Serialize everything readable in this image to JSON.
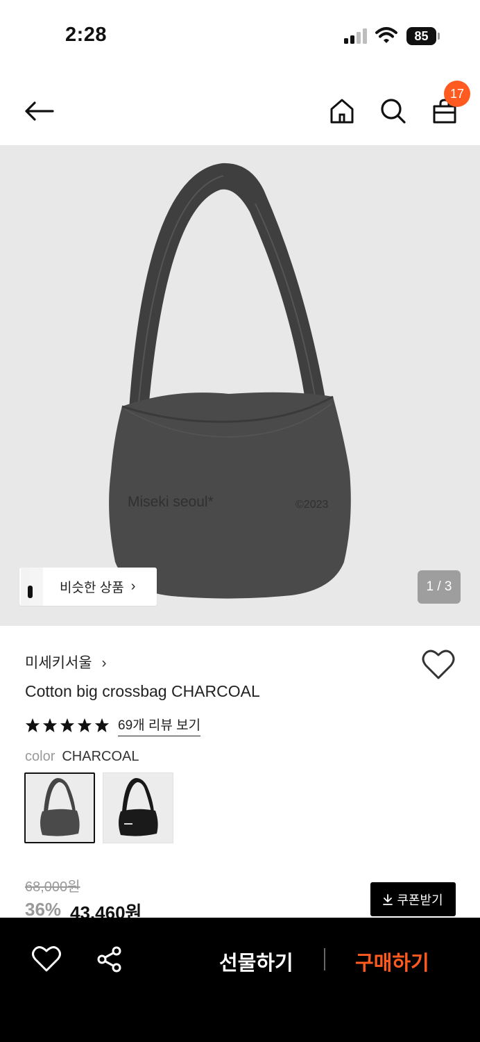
{
  "status_bar": {
    "time": "2:28",
    "battery": "85"
  },
  "header": {
    "icons": [
      "back-arrow-icon",
      "home-icon",
      "search-icon",
      "shopping-bag-icon"
    ],
    "cart_count": "17"
  },
  "gallery": {
    "similar_label": "비슷한 상품",
    "page_indicator": "1 / 3",
    "bag_print_left": "Miseki seoul*",
    "bag_print_right": "©2023"
  },
  "product": {
    "brand": "미세키서울",
    "name": "Cotton big crossbag CHARCOAL",
    "rating_stars": 5,
    "review_link": "69개 리뷰 보기",
    "color_label": "color",
    "color_value": "CHARCOAL"
  },
  "price": {
    "original": "68,000원",
    "discount": "36%",
    "sale": "43,460원",
    "coupon_label": "쿠폰받기"
  },
  "bottom_bar": {
    "gift_label": "선물하기",
    "buy_label": "구매하기"
  },
  "colors": {
    "accent": "#ff5a1f",
    "bag_charcoal": "#4a4a4a",
    "bag_black": "#1a1a1a"
  }
}
